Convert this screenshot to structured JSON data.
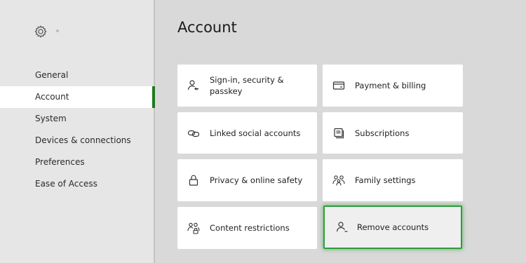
{
  "sidebar": {
    "items": [
      {
        "label": "General"
      },
      {
        "label": "Account"
      },
      {
        "label": "System"
      },
      {
        "label": "Devices & connections"
      },
      {
        "label": "Preferences"
      },
      {
        "label": "Ease of Access"
      }
    ],
    "active_item": "Account"
  },
  "main": {
    "title": "Account",
    "tiles": [
      {
        "label": "Sign-in, security & passkey",
        "icon": "person-key-icon"
      },
      {
        "label": "Payment & billing",
        "icon": "card-icon"
      },
      {
        "label": "Linked social accounts",
        "icon": "link-icon"
      },
      {
        "label": "Subscriptions",
        "icon": "subscription-icon"
      },
      {
        "label": "Privacy & online safety",
        "icon": "lock-icon"
      },
      {
        "label": "Family settings",
        "icon": "family-icon"
      },
      {
        "label": "Content restrictions",
        "icon": "people-lock-icon"
      },
      {
        "label": "Remove accounts",
        "icon": "person-remove-icon"
      }
    ],
    "focused_tile": "Remove accounts"
  },
  "colors": {
    "accent": "#1f7a1f",
    "focus_ring": "#2e9d3a",
    "background": "#d9d9d9",
    "sidebar": "#e6e6e6",
    "tile": "#ffffff"
  }
}
